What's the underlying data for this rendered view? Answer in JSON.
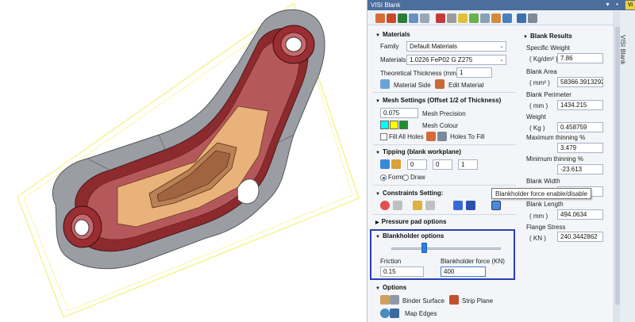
{
  "app": {
    "title": "VISI Blank",
    "side_tab_label": "VISI Blank",
    "logo_text": "Vi"
  },
  "materials": {
    "header": "Materials",
    "family_label": "Family",
    "family_value": "Default Materials",
    "materials_label": "Materials",
    "materials_value": "1.0226 FeP02 G Z275",
    "thickness_label": "Theoretical Thickness (mm)",
    "thickness_value": "1",
    "material_side_label": "Material Side",
    "edit_material_label": "Edit Material"
  },
  "mesh": {
    "header": "Mesh Settings (Offset 1/2 of Thickness)",
    "precision_value": "0.075",
    "precision_label": "Mesh Precision",
    "colour_label": "Mesh Colour",
    "colours": [
      "#00ffff",
      "#ffff00",
      "#1f8f2a"
    ],
    "fill_all_holes_label": "Fill All Holes",
    "holes_to_fill_label": "Holes To Fill"
  },
  "tipping": {
    "header": "Tipping (blank workplane)",
    "values": [
      "0",
      "0",
      "1"
    ],
    "form_label": "Form",
    "draw_label": "Draw",
    "selected": "Form"
  },
  "constraints": {
    "header": "Constraints Setting:"
  },
  "pressure_pad": {
    "header": "Pressure pad options"
  },
  "blankholder": {
    "header": "Blankholder options",
    "slider_position": 0.3,
    "friction_label": "Friction",
    "friction_value": "0.15",
    "force_label": "Blankholder force (KN)",
    "force_value": "400"
  },
  "tooltip": "Blankholder force enable/disable",
  "options": {
    "header": "Options",
    "binder_surface_label": "Binder Surface",
    "strip_plane_label": "Strip Plane",
    "map_edges_label": "Map Edges"
  },
  "results": {
    "header": "Blank Results",
    "specific_weight_label": "Specific Weight",
    "specific_weight_unit": "( Kg/dm³ )",
    "specific_weight_value": "7.86",
    "area_label": "Blank Area",
    "area_unit": "( mm² )",
    "area_value": "58366.39132929",
    "perimeter_label": "Blank Perimeter",
    "perimeter_unit": "( mm )",
    "perimeter_value": "1434.215",
    "weight_label": "Weight",
    "weight_unit": "( Kg )",
    "weight_value": "0.458759",
    "max_thinning_label": "Maximum thinning %",
    "max_thinning_value": "3.479",
    "min_thinning_label": "Minimum thinning %",
    "min_thinning_value": "-23.613",
    "width_label": "Blank Width",
    "length_label": "Blank Length",
    "length_unit": "( mm )",
    "length_value": "494.0634",
    "flange_label": "Flange Stress",
    "flange_unit": "( KN )",
    "flange_value": "240.3442862"
  }
}
